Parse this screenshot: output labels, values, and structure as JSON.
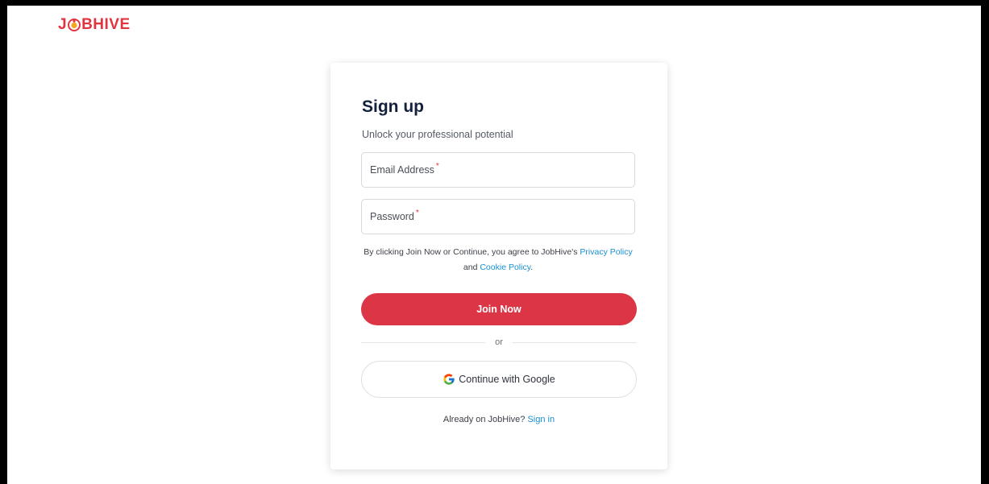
{
  "brand": {
    "logo_prefix": "J",
    "logo_suffix": "BHIVE",
    "accent_color": "#e2343f"
  },
  "signup": {
    "title": "Sign up",
    "subtitle": "Unlock your professional potential",
    "email_label": "Email Address",
    "password_label": "Password",
    "required_mark": "*",
    "terms_prefix": "By clicking Join Now or Continue, you agree to JobHive's",
    "privacy_link": "Privacy Policy",
    "terms_and": "and",
    "cookie_link": "Cookie Policy",
    "terms_suffix": ".",
    "join_button": "Join Now",
    "divider_text": "or",
    "google_button": "Continue with Google",
    "google_icon": "google-icon",
    "signin_prompt": "Already on JobHive?",
    "signin_link": "Sign in",
    "join_button_color": "#dc3545",
    "link_color": "#1a8fd1"
  }
}
